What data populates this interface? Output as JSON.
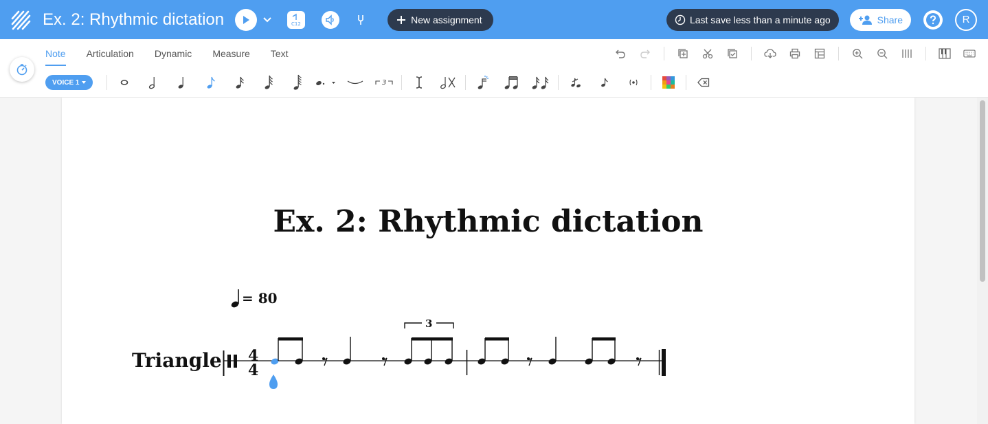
{
  "header": {
    "title": "Ex. 2: Rhythmic dictation",
    "new_assignment_label": "New assignment",
    "save_status": "Last save less than a minute ago",
    "share_label": "Share",
    "avatar_initial": "R",
    "clef_badge_text": "C12"
  },
  "tabs": [
    {
      "label": "Note",
      "active": true
    },
    {
      "label": "Articulation",
      "active": false
    },
    {
      "label": "Dynamic",
      "active": false
    },
    {
      "label": "Measure",
      "active": false
    },
    {
      "label": "Text",
      "active": false
    }
  ],
  "voice": {
    "label": "VOICE 1"
  },
  "tuplet_label": "3",
  "score": {
    "title": "Ex. 2: Rhythmic dictation",
    "tempo_value": "= 80",
    "instrument": "Triangle",
    "time_signature": {
      "top": "4",
      "bottom": "4"
    },
    "tuplet_number": "3"
  },
  "colors": {
    "header_bg": "#4f9ef0",
    "dark_pill": "#2d3a4e",
    "accent": "#4f9ef0"
  },
  "icons": {
    "logo": "stripes-logo-icon",
    "play": "play-icon",
    "chevron": "chevron-down-icon",
    "speaker": "speaker-icon",
    "tuning": "tuning-fork-icon",
    "clock": "clock-icon",
    "help": "question-icon"
  }
}
